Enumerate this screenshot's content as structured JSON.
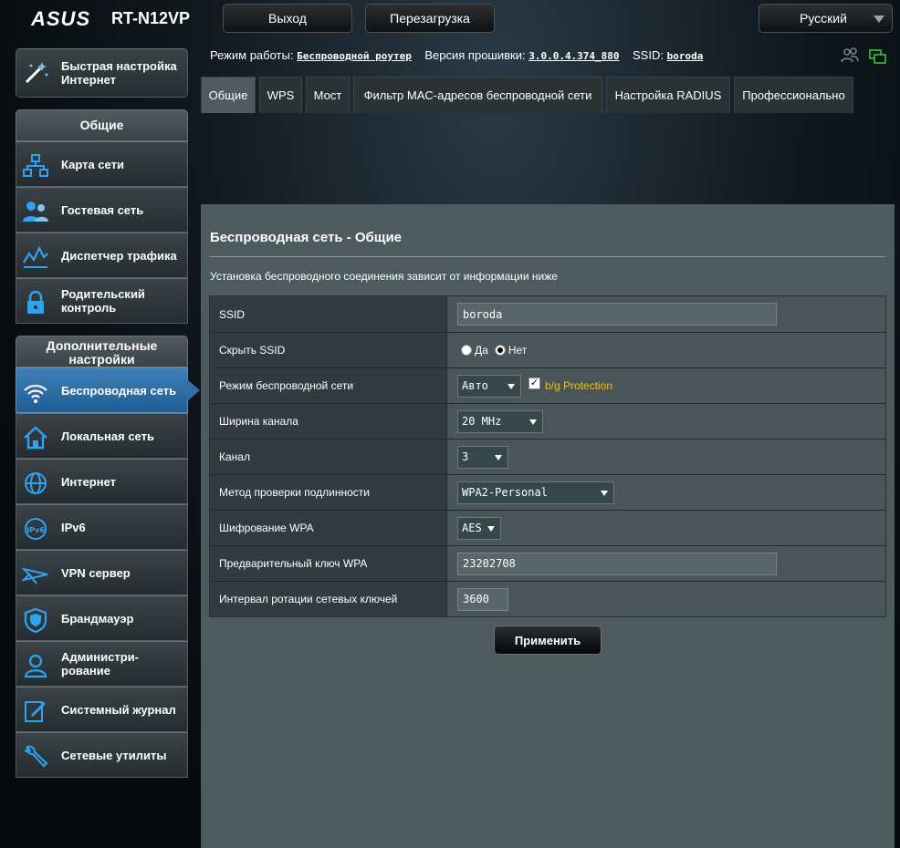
{
  "header": {
    "logo": "ASUS",
    "model": "RT-N12VP",
    "logout_label": "Выход",
    "reboot_label": "Перезагрузка",
    "language": "Русский"
  },
  "infobar": {
    "mode_label": "Режим работы:",
    "mode_value": "Беспроводной роутер",
    "firmware_label": "Версия прошивки:",
    "firmware_value": "3.0.0.4.374_880",
    "ssid_label": "SSID:",
    "ssid_value": "boroda"
  },
  "sidebar": {
    "quick_setup": "Быстрая настройка Интернет",
    "general_header": "Общие",
    "general_items": [
      {
        "label": "Карта сети",
        "icon": "network-map-icon"
      },
      {
        "label": "Гостевая сеть",
        "icon": "guest-network-icon"
      },
      {
        "label": "Диспетчер трафика",
        "icon": "traffic-manager-icon"
      },
      {
        "label": "Родительский контроль",
        "icon": "parental-control-icon"
      }
    ],
    "advanced_header": "Дополнительные настройки",
    "advanced_items": [
      {
        "label": "Беспроводная сеть",
        "icon": "wireless-icon"
      },
      {
        "label": "Локальная сеть",
        "icon": "lan-icon"
      },
      {
        "label": "Интернет",
        "icon": "globe-icon"
      },
      {
        "label": "IPv6",
        "icon": "ipv6-icon"
      },
      {
        "label": "VPN сервер",
        "icon": "vpn-icon"
      },
      {
        "label": "Брандмауэр",
        "icon": "firewall-icon"
      },
      {
        "label": "Администри-рование",
        "icon": "admin-icon"
      },
      {
        "label": "Системный журнал",
        "icon": "syslog-icon"
      },
      {
        "label": "Сетевые утилиты",
        "icon": "tools-icon"
      }
    ]
  },
  "tabs": [
    "Общие",
    "WPS",
    "Мост",
    "Фильтр MAC-адресов беспроводной сети",
    "Настройка RADIUS",
    "Профессионально"
  ],
  "panel": {
    "title": "Беспроводная сеть - Общие",
    "description": "Установка беспроводного соединения зависит от информации ниже",
    "apply_label": "Применить"
  },
  "form": {
    "ssid_label": "SSID",
    "ssid_value": "boroda",
    "hide_ssid_label": "Скрыть SSID",
    "hide_yes": "Да",
    "hide_no": "Нет",
    "hide_selected": "Нет",
    "mode_label": "Режим беспроводной сети",
    "mode_value": "Авто",
    "bg_protection": "b/g Protection",
    "bg_protection_checked": true,
    "width_label": "Ширина канала",
    "width_value": "20 MHz",
    "channel_label": "Канал",
    "channel_value": "3",
    "auth_label": "Метод проверки подлинности",
    "auth_value": "WPA2-Personal",
    "enc_label": "Шифрование WPA",
    "enc_value": "AES",
    "psk_label": "Предварительный ключ WPA",
    "psk_value": "23202708",
    "interval_label": "Интервал ротации сетевых ключей",
    "interval_value": "3600"
  },
  "colors": {
    "accent_blue": "#2f6ea6",
    "bg_protection_text": "#f5c400",
    "panel_bg": "#4d5a5e"
  }
}
